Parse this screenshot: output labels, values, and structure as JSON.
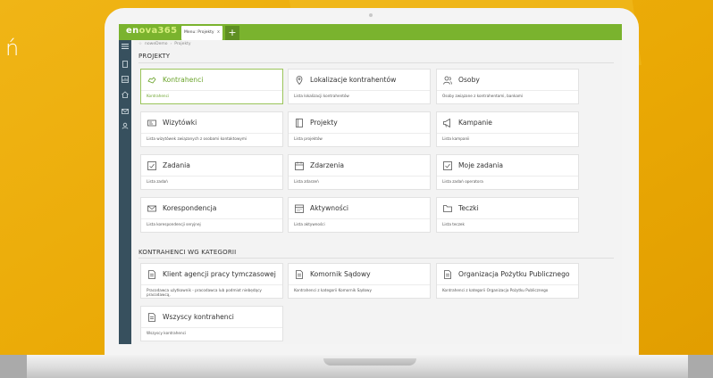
{
  "background": {
    "glyph": "ń",
    "accent_color": "#e9ad0a"
  },
  "app": {
    "logo_main": "en",
    "logo_accent": "ova365",
    "brand_color": "#7ab32e",
    "tab_label": "Menu: Projekty",
    "tab_close": "x",
    "tab_add": "+"
  },
  "breadcrumb": {
    "items": [
      "noweDemo",
      "Projekty"
    ]
  },
  "sidebar": {
    "icons": [
      "hamburger-icon",
      "document-icon",
      "chart-icon",
      "home-icon",
      "mail-icon",
      "user-icon"
    ]
  },
  "sections": [
    {
      "title": "PROJEKTY",
      "cards": [
        {
          "title": "Kontrahenci",
          "desc": "Kontrahenci",
          "icon": "handshake-icon",
          "active": true
        },
        {
          "title": "Lokalizacje kontrahentów",
          "desc": "Lista lokalizacji kontrahentów",
          "icon": "location-pin-icon"
        },
        {
          "title": "Osoby",
          "desc": "Osoby związane z kontrahentami, bankami",
          "icon": "people-icon"
        },
        {
          "title": "Wizytówki",
          "desc": "Lista wizytówek związanych z osobami kontaktowymi",
          "icon": "business-card-icon"
        },
        {
          "title": "Projekty",
          "desc": "Lista projektów",
          "icon": "folder-icon"
        },
        {
          "title": "Kampanie",
          "desc": "Lista kampanii",
          "icon": "megaphone-icon"
        },
        {
          "title": "Zadania",
          "desc": "Lista zadań",
          "icon": "task-icon"
        },
        {
          "title": "Zdarzenia",
          "desc": "Lista zdarzeń",
          "icon": "calendar-icon"
        },
        {
          "title": "Moje zadania",
          "desc": "Lista zadań operatora",
          "icon": "checkbox-icon"
        },
        {
          "title": "Korespondencja",
          "desc": "Lista korespondencji seryjnej",
          "icon": "envelope-icon"
        },
        {
          "title": "Aktywności",
          "desc": "Lista aktywności",
          "icon": "activity-icon"
        },
        {
          "title": "Teczki",
          "desc": "Lista teczek",
          "icon": "folder-open-icon"
        }
      ]
    },
    {
      "title": "KONTRAHENCI WG KATEGORII",
      "cards": [
        {
          "title": "Klient agencji pracy tymczasowej",
          "desc": "Pracodawca użytkownik - pracodawca lub podmiot niebędący pracodawcą,",
          "icon": "document-icon"
        },
        {
          "title": "Komornik Sądowy",
          "desc": "Kontrahenci z kategorii Komornik Sądowy",
          "icon": "document-icon"
        },
        {
          "title": "Organizacja Pożytku Publicznego",
          "desc": "Kontrahenci z kategorii Organizacja Pożytku Publicznego",
          "icon": "document-icon"
        },
        {
          "title": "Wszyscy kontrahenci",
          "desc": "Wszyscy kontrahenci",
          "icon": "document-icon"
        }
      ]
    }
  ]
}
